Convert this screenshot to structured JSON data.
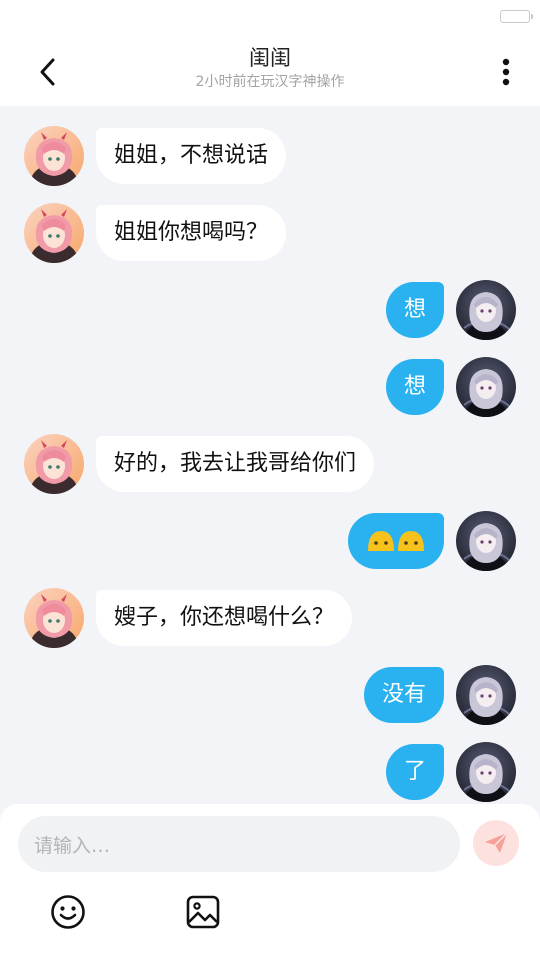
{
  "header": {
    "title": "闺闺",
    "subtitle": "2小时前在玩汉字神操作"
  },
  "icons": {
    "back": "chevron-left-icon",
    "more": "more-vertical-icon",
    "send": "paper-plane-icon",
    "emoji": "smiley-icon",
    "image": "image-icon",
    "battery": "battery-icon"
  },
  "colors": {
    "outgoing_bubble": "#29b1f0",
    "incoming_bubble": "#ffffff",
    "background": "#f2f4f7",
    "send_button": "#fde1df",
    "send_icon": "#f7a09a"
  },
  "messages": [
    {
      "side": "left",
      "text": "姐姐，不想说话"
    },
    {
      "side": "left",
      "text": "姐姐你想喝吗？"
    },
    {
      "side": "right",
      "text": "想"
    },
    {
      "side": "right",
      "text": "想"
    },
    {
      "side": "left",
      "text": "好的，我去让我哥给你们"
    },
    {
      "side": "right",
      "text": "",
      "emoji": "two-yellow-faces"
    },
    {
      "side": "left",
      "text": "嫂子，你还想喝什么？"
    },
    {
      "side": "right",
      "text": "没有"
    },
    {
      "side": "right",
      "text": "了"
    }
  ],
  "composer": {
    "placeholder": "请输入…"
  }
}
